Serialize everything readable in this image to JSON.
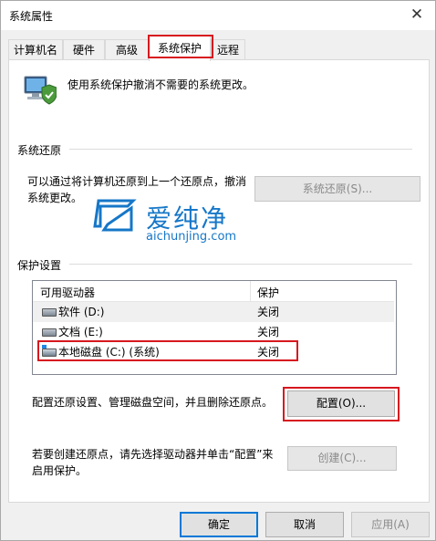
{
  "window": {
    "title": "系统属性",
    "close_glyph": "✕"
  },
  "tabs": [
    {
      "label": "计算机名"
    },
    {
      "label": "硬件"
    },
    {
      "label": "高级"
    },
    {
      "label": "系统保护"
    },
    {
      "label": "远程"
    }
  ],
  "active_tab": "系统保护",
  "header_text": "使用系统保护撤消不需要的系统更改。",
  "restore": {
    "section_label": "系统还原",
    "description": "可以通过将计算机还原到上一个还原点，撤消系统更改。",
    "button_label": "系统还原(S)..."
  },
  "watermark": {
    "brand": "爱纯净",
    "url": "aichunjing.com"
  },
  "protection": {
    "section_label": "保护设置",
    "columns": [
      "可用驱动器",
      "保护"
    ],
    "drives": [
      {
        "name": "软件 (D:)",
        "status": "关闭"
      },
      {
        "name": "文档 (E:)",
        "status": "关闭"
      },
      {
        "name": "本地磁盘 (C:) (系统)",
        "status": "关闭"
      }
    ],
    "configure_text": "配置还原设置、管理磁盘空间，并且删除还原点。",
    "configure_button": "配置(O)...",
    "create_text": "若要创建还原点，请先选择驱动器并单击“配置”来启用保护。",
    "create_button": "创建(C)..."
  },
  "footer": {
    "ok": "确定",
    "cancel": "取消",
    "apply": "应用(A)"
  },
  "colors": {
    "highlight": "#d7181f",
    "accent": "#0078d7"
  }
}
